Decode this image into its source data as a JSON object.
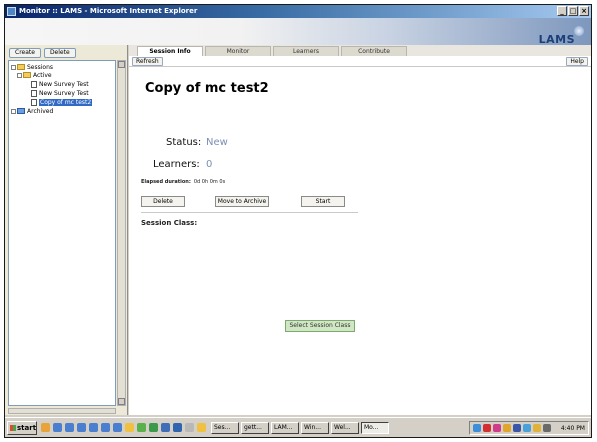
{
  "window": {
    "title": "Monitor :: LAMS - Microsoft Internet Explorer",
    "controls": [
      "_",
      "□",
      "×"
    ]
  },
  "brand": {
    "logo": "LAMS"
  },
  "sidebar": {
    "create_label": "Create",
    "delete_label": "Delete",
    "tree": {
      "sessions": "Sessions",
      "active": "Active",
      "items": [
        "New Survey Test",
        "New Survey Test",
        "Copy of mc test2"
      ],
      "archived": "Archived"
    }
  },
  "tabs": [
    "Session Info",
    "Monitor",
    "Learners",
    "Contribute"
  ],
  "toolbar": {
    "refresh_label": "Refresh",
    "help_label": "Help"
  },
  "session": {
    "title": "Copy of mc test2",
    "status_label": "Status:",
    "status_value": "New",
    "learners_label": "Learners:",
    "learners_value": "0",
    "elapsed_label": "Elapsed duration:",
    "elapsed_value": "0d 0h 0m 0s"
  },
  "actions": {
    "delete_label": "Delete",
    "archive_label": "Move to Archive",
    "start_label": "Start"
  },
  "session_class": {
    "label": "Session Class:",
    "select_label": "Select Session Class"
  },
  "taskbar": {
    "start_label": "start",
    "tasks": [
      "Ses...",
      "gett...",
      "LAM...",
      "Win...",
      "Wel...",
      "Mo..."
    ],
    "clock": "4:40 PM"
  },
  "colors": {
    "titlebar": "#0a246a",
    "accent_value": "#7a8fb5",
    "select_button": "#cfe7c3"
  }
}
